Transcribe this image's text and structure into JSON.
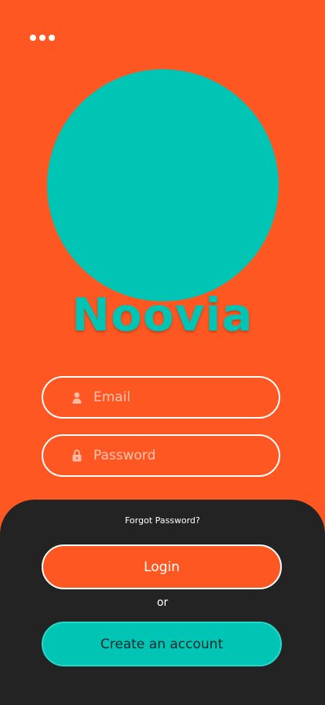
{
  "header": {
    "menu_icon": "more-horizontal-icon"
  },
  "brand": {
    "name": "Noovia",
    "logo_color": "#00c4b4"
  },
  "form": {
    "email": {
      "placeholder": "Email",
      "value": "",
      "icon": "user-icon"
    },
    "password": {
      "placeholder": "Password",
      "value": "",
      "icon": "lock-icon"
    }
  },
  "actions": {
    "forgot_label": "Forgot Password?",
    "login_label": "Login",
    "or_label": "or",
    "create_label": "Create an account"
  },
  "colors": {
    "background": "#ff5722",
    "accent": "#00c4b4",
    "panel": "#232323"
  }
}
